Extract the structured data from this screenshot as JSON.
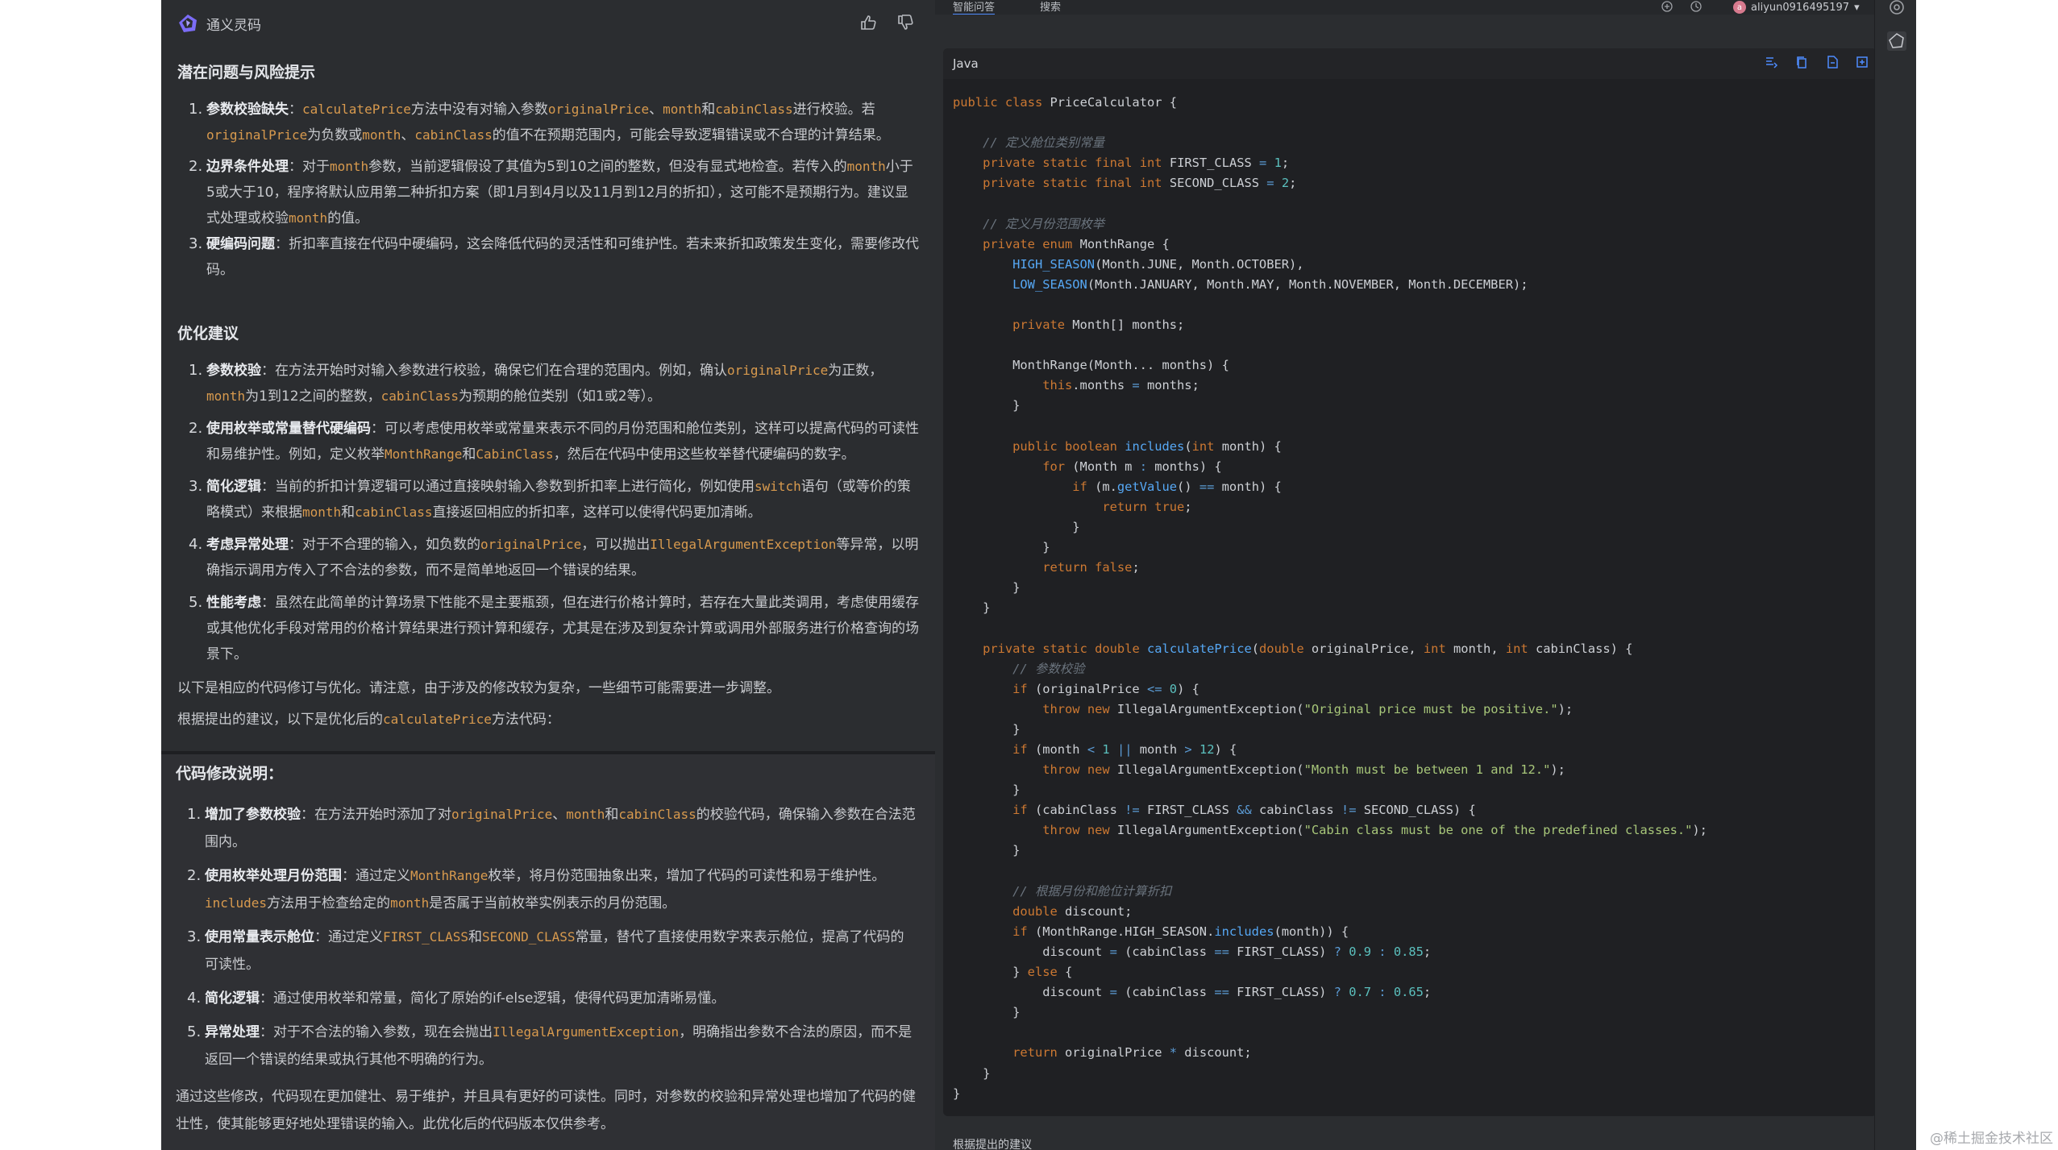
{
  "chat": {
    "brand": "通义灵码",
    "sections": [
      {
        "title": "潜在问题与风险提示",
        "items": [
          {
            "label": "参数校验缺失",
            "text": "：calculatePrice方法中没有对输入参数originalPrice、month和cabinClass进行校验。若 originalPrice为负数或month、cabinClass的值不在预期范围内，可能会导致逻辑错误或不合理的计算结果。"
          },
          {
            "label": "边界条件处理",
            "text": "：对于month参数，当前逻辑假设了其值为5到10之间的整数，但没有显式地检查。若传入的month小于5或大于10，程序将默认应用第二种折扣方案（即1月到4月以及11月到12月的折扣），这可能不是预期行为。建议显式处理或校验month的值。"
          },
          {
            "label": "硬编码问题",
            "text": "：折扣率直接在代码中硬编码，这会降低代码的灵活性和可维护性。若未来折扣政策发生变化，需要修改代码。"
          }
        ]
      },
      {
        "title": "优化建议",
        "items": [
          {
            "label": "参数校验",
            "text": "：在方法开始时对输入参数进行校验，确保它们在合理的范围内。例如，确认originalPrice为正数，month为1到12之间的整数，cabinClass为预期的舱位类别（如1或2等）。"
          },
          {
            "label": "使用枚举或常量替代硬编码",
            "text": "：可以考虑使用枚举或常量来表示不同的月份范围和舱位类别，这样可以提高代码的可读性和易维护性。例如，定义枚举MonthRange和CabinClass，然后在代码中使用这些枚举替代硬编码的数字。"
          },
          {
            "label": "简化逻辑",
            "text": "：当前的折扣计算逻辑可以通过直接映射输入参数到折扣率上进行简化，例如使用switch语句（或等价的策略模式）来根据month和cabinClass直接返回相应的折扣率，这样可以使得代码更加清晰。"
          },
          {
            "label": "考虑异常处理",
            "text": "：对于不合理的输入，如负数的originalPrice，可以抛出IllegalArgumentException等异常，以明确指示调用方传入了不合法的参数，而不是简单地返回一个错误的结果。"
          },
          {
            "label": "性能考虑",
            "text": "：虽然在此简单的计算场景下性能不是主要瓶颈，但在进行价格计算时，若存在大量此类调用，考虑使用缓存或其他优化手段对常用的价格计算结果进行预计算和缓存，尤其是在涉及到复杂计算或调用外部服务进行价格查询的场景下。"
          }
        ]
      }
    ],
    "para1": "以下是相应的代码修订与优化。请注意，由于涉及的修改较为复杂，一些细节可能需要进一步调整。",
    "para2_prefix": "根据提出的建议，以下是优化后的",
    "para2_code": "calculatePrice",
    "para2_suffix": "方法代码：",
    "changes_title": "代码修改说明：",
    "changes": [
      {
        "label": "增加了参数校验",
        "text": "：在方法开始时添加了对originalPrice、month和cabinClass的校验代码，确保输入参数在合法范围内。"
      },
      {
        "label": "使用枚举处理月份范围",
        "text": "：通过定义MonthRange枚举，将月份范围抽象出来，增加了代码的可读性和易于维护性。includes方法用于检查给定的month是否属于当前枚举实例表示的月份范围。"
      },
      {
        "label": "使用常量表示舱位",
        "text": "：通过定义FIRST_CLASS和SECOND_CLASS常量，替代了直接使用数字来表示舱位，提高了代码的可读性。"
      },
      {
        "label": "简化逻辑",
        "text": "：通过使用枚举和常量，简化了原始的if-else逻辑，使得代码更加清晰易懂。"
      },
      {
        "label": "异常处理",
        "text": "：对于不合法的输入参数，现在会抛出IllegalArgumentException，明确指出参数不合法的原因，而不是返回一个错误的结果或执行其他不明确的行为。"
      }
    ],
    "conclusion": "通过这些修改，代码现在更加健壮、易于维护，并且具有更好的可读性。同时，对参数的校验和异常处理也增加了代码的健壮性，使其能够更好地处理错误的输入。此优化后的代码版本仅供参考。"
  },
  "topbar": {
    "tab1": "智能问答",
    "tab2": "搜索",
    "username": "aliyun0916495197"
  },
  "code": {
    "language": "Java",
    "lines": [
      "public class PriceCalculator {",
      "",
      "    // 定义舱位类别常量",
      "    private static final int FIRST_CLASS = 1;",
      "    private static final int SECOND_CLASS = 2;",
      "",
      "    // 定义月份范围枚举",
      "    private enum MonthRange {",
      "        HIGH_SEASON(Month.JUNE, Month.OCTOBER),",
      "        LOW_SEASON(Month.JANUARY, Month.MAY, Month.NOVEMBER, Month.DECEMBER);",
      "",
      "        private Month[] months;",
      "",
      "        MonthRange(Month... months) {",
      "            this.months = months;",
      "        }",
      "",
      "        public boolean includes(int month) {",
      "            for (Month m : months) {",
      "                if (m.getValue() == month) {",
      "                    return true;",
      "                }",
      "            }",
      "            return false;",
      "        }",
      "    }",
      "",
      "    private static double calculatePrice(double originalPrice, int month, int cabinClass) {",
      "        // 参数校验",
      "        if (originalPrice <= 0) {",
      "            throw new IllegalArgumentException(\"Original price must be positive.\");",
      "        }",
      "        if (month < 1 || month > 12) {",
      "            throw new IllegalArgumentException(\"Month must be between 1 and 12.\");",
      "        }",
      "        if (cabinClass != FIRST_CLASS && cabinClass != SECOND_CLASS) {",
      "            throw new IllegalArgumentException(\"Cabin class must be one of the predefined classes.\");",
      "        }",
      "",
      "        // 根据月份和舱位计算折扣",
      "        double discount;",
      "        if (MonthRange.HIGH_SEASON.includes(month)) {",
      "            discount = (cabinClass == FIRST_CLASS) ? 0.9 : 0.85;",
      "        } else {",
      "            discount = (cabinClass == FIRST_CLASS) ? 0.7 : 0.65;",
      "        }",
      "",
      "        return originalPrice * discount;",
      "    }",
      "}"
    ]
  },
  "bottom_text": "根据提出的建议",
  "watermark": "@稀土掘金技术社区",
  "colors": {
    "accent": "#d89a4e",
    "keyword": "#cc7832",
    "function": "#56a8f5",
    "string": "#a8c77a",
    "number": "#5bc0be"
  }
}
